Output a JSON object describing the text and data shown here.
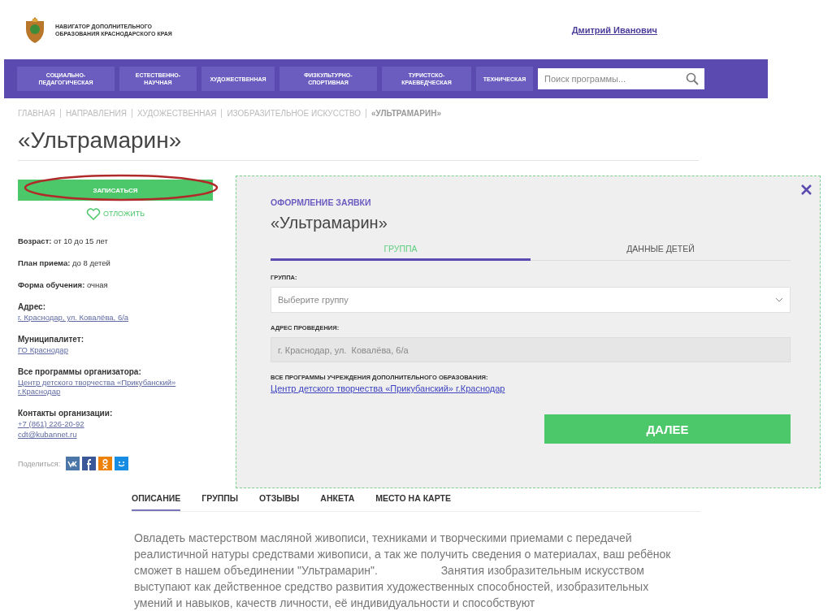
{
  "header": {
    "logo_text": "НАВИГАТОР ДОПОЛНИТЕЛЬНОГО ОБРАЗОВАНИЯ КРАСНОДАРСКОГО КРАЯ",
    "user_name": "Дмитрий Иванович"
  },
  "nav": {
    "items": [
      {
        "label": "СОЦИАЛЬНО-ПЕДАГОГИЧЕСКАЯ"
      },
      {
        "label": "ЕСТЕСТВЕННО-НАУЧНАЯ"
      },
      {
        "label": "ХУДОЖЕСТВЕННАЯ"
      },
      {
        "label": "ФИЗКУЛЬТУРНО-СПОРТИВНАЯ"
      },
      {
        "label": "ТУРИСТСКО-КРАЕВЕДЧЕСКАЯ"
      },
      {
        "label": "ТЕХНИЧЕСКАЯ"
      }
    ],
    "search": {
      "placeholder": "Поиск программы..."
    }
  },
  "breadcrumb": [
    {
      "label": "ГЛАВНАЯ",
      "current": false
    },
    {
      "label": "НАПРАВЛЕНИЯ",
      "current": false
    },
    {
      "label": "ХУДОЖЕСТВЕННАЯ",
      "current": false
    },
    {
      "label": "ИЗОБРАЗИТЕЛЬНОЕ ИСКУССТВО",
      "current": false
    },
    {
      "label": "«УЛЬТРАМАРИН»",
      "current": true
    }
  ],
  "title": "«Ультрамарин»",
  "sidebar": {
    "enroll_button": "ЗАПИСАТЬСЯ",
    "favorite": "ОТЛОЖИТЬ",
    "info": [
      {
        "kind": "inline",
        "label": "Возраст:",
        "values": [
          "от 10 до 15 лет"
        ]
      },
      {
        "kind": "inline",
        "label": "План приема:",
        "values": [
          "до 8 детей"
        ]
      },
      {
        "kind": "inline",
        "label": "Форма обучения:",
        "values": [
          "очная"
        ]
      },
      {
        "kind": "links",
        "label": "Адрес:",
        "values": [
          "г. Краснодар, ул. Ковалёва, 6/а"
        ]
      },
      {
        "kind": "links",
        "label": "Муниципалитет:",
        "values": [
          "ГО Краснодар"
        ]
      },
      {
        "kind": "links",
        "label": "Все программы организатора:",
        "values": [
          "Центр детского творчества «Прикубанский» г.Краснодар"
        ]
      },
      {
        "kind": "links",
        "label": "Контакты организации:",
        "values": [
          "+7 (861) 226-20-92",
          "cdt@kubannet.ru"
        ]
      }
    ],
    "share_label": "Поделиться:"
  },
  "modal": {
    "kicker": "ОФОРМЛЕНИЕ ЗАЯВКИ",
    "title": "«Ультрамарин»",
    "tabs": [
      {
        "label": "ГРУППА",
        "selected": true
      },
      {
        "label": "ДАННЫЕ ДЕТЕЙ",
        "selected": false
      }
    ],
    "group_label": "ГРУППА:",
    "group_placeholder": "Выберите группу",
    "address_label": "АДРЕС ПРОВЕДЕНИЯ:",
    "address_value": "г. Краснодар, ул.  Ковалёва, 6/а",
    "programs_label": "ВСЕ ПРОГРАММЫ УЧРЕЖДЕНИЯ ДОПОЛНИТЕЛЬНОГО ОБРАЗОВАНИЯ:",
    "programs_link": "Центр детского творчества «Прикубанский» г.Краснодар",
    "next_button": "ДАЛЕЕ"
  },
  "content_tabs": [
    {
      "label": "ОПИСАНИЕ",
      "selected": true
    },
    {
      "label": "ГРУППЫ",
      "selected": false
    },
    {
      "label": "ОТЗЫВЫ",
      "selected": false
    },
    {
      "label": "АНКЕТА",
      "selected": false
    },
    {
      "label": "МЕСТО НА КАРТЕ",
      "selected": false
    }
  ],
  "description": "Овладеть мастерством масляной живописи, техниками и творческими приемами с передачей реалистичной натуры средствами живописи, а так же получить сведения о материалах, ваш ребёнок сможет в нашем объединении \"Ультрамарин\".                    Занятия изобразительным искусством выступают как действенное средство развития художественных способностей, изобразительных умений и навыков, качеств личности, её индивидуальности и способствуют"
}
